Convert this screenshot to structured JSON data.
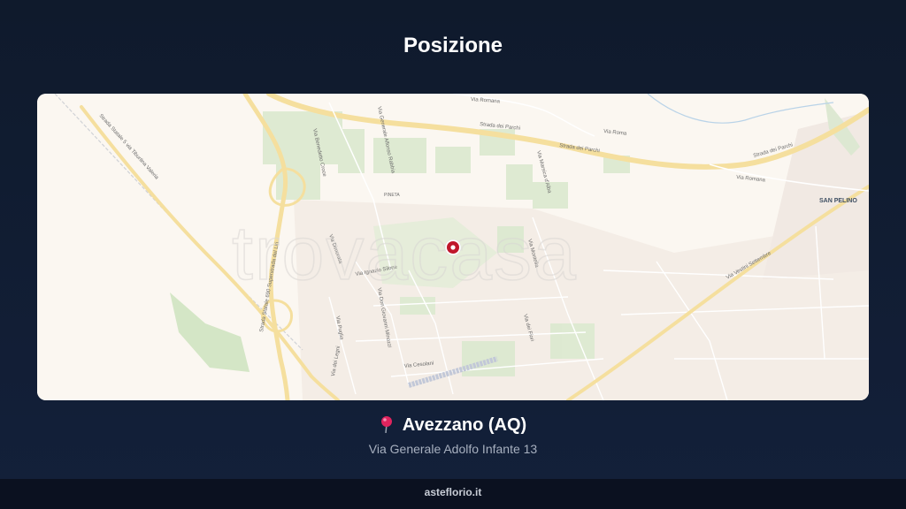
{
  "page": {
    "title": "Posizione"
  },
  "map": {
    "watermark": "trovacasa",
    "place_labels": [
      "SAN PELINO",
      "PINETA"
    ],
    "road_labels": [
      "Via Romana",
      "Strada dei Parchi",
      "Via Roma",
      "Strada Statale 5 via Tiburtina Valeria",
      "Strada Statale 690 Superstrada del Liri",
      "Via Generale Alfonso Rabbia",
      "Via Benedetto Croce",
      "Via Marsica d'Alba",
      "Via Vestini Settembre",
      "Via Ignazio Silone",
      "Via Don Giovanni Minozzi",
      "Via Puglia",
      "Via dei Legni",
      "Via Cesolani",
      "Via dei Fiori",
      "Via Dimorata",
      "Via Montella"
    ],
    "marker_color": "#c0172c"
  },
  "location": {
    "city": "Avezzano (AQ)",
    "address": "Via Generale Adolfo Infante 13"
  },
  "footer": {
    "site": "asteflorio.it"
  }
}
